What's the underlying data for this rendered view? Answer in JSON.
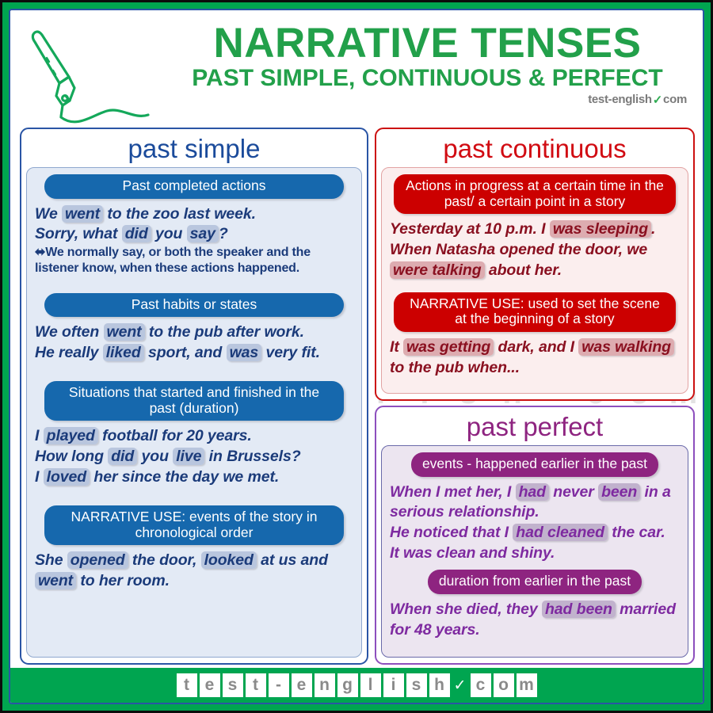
{
  "header": {
    "title": "NARRATIVE TENSES",
    "subtitle": "PAST SIMPLE, CONTINUOUS & PERFECT",
    "brand_left": "test-english",
    "brand_check": "✓",
    "brand_right": "com",
    "pen_icon": "fountain-pen-icon"
  },
  "colors": {
    "green": "#00A550",
    "blue": "#1668AD",
    "blue_text": "#1b4b9b",
    "red": "#CC0000",
    "red_text": "#d10b12",
    "purple": "#8E2480",
    "purple_text": "#8e2480",
    "highlight_blue": "#b9c6de",
    "highlight_red": "#ddacb0",
    "highlight_purple": "#c1b2cd"
  },
  "watermark": {
    "tiles": [
      "t",
      "e",
      "s",
      "t",
      "-",
      "e",
      "n",
      "g",
      "l",
      "i",
      "s",
      "h"
    ],
    "mark": "✓",
    "tail": [
      "c",
      "o",
      "m"
    ]
  },
  "past_simple": {
    "title": "past simple",
    "sections": [
      {
        "heading": "Past completed actions",
        "examples": [
          [
            {
              "t": "We ",
              "h": false
            },
            {
              "t": "went",
              "h": true
            },
            {
              "t": " to the zoo last week.",
              "h": false
            }
          ],
          [
            {
              "t": "Sorry, what ",
              "h": false
            },
            {
              "t": "did",
              "h": true
            },
            {
              "t": " you ",
              "h": false
            },
            {
              "t": "say",
              "h": true
            },
            {
              "t": "?",
              "h": false
            }
          ]
        ],
        "note": "⬌We normally say, or both the speaker and the listener know, when these actions happened."
      },
      {
        "heading": "Past habits or states",
        "examples": [
          [
            {
              "t": "We often ",
              "h": false
            },
            {
              "t": "went",
              "h": true
            },
            {
              "t": " to the pub after work.",
              "h": false
            }
          ],
          [
            {
              "t": "He really ",
              "h": false
            },
            {
              "t": "liked",
              "h": true
            },
            {
              "t": " sport, and ",
              "h": false
            },
            {
              "t": "was",
              "h": true
            },
            {
              "t": " very fit.",
              "h": false
            }
          ]
        ],
        "note": ""
      },
      {
        "heading": "Situations that started and finished in the past (duration)",
        "examples": [
          [
            {
              "t": "I ",
              "h": false
            },
            {
              "t": "played",
              "h": true
            },
            {
              "t": " football for 20 years.",
              "h": false
            }
          ],
          [
            {
              "t": "How long ",
              "h": false
            },
            {
              "t": "did",
              "h": true
            },
            {
              "t": " you ",
              "h": false
            },
            {
              "t": "live",
              "h": true
            },
            {
              "t": " in Brussels?",
              "h": false
            }
          ],
          [
            {
              "t": "I ",
              "h": false
            },
            {
              "t": "loved",
              "h": true
            },
            {
              "t": " her since the day we met.",
              "h": false
            }
          ]
        ],
        "note": ""
      },
      {
        "heading": "NARRATIVE USE: events of the story in chronological order",
        "examples": [
          [
            {
              "t": "She ",
              "h": false
            },
            {
              "t": "opened",
              "h": true
            },
            {
              "t": " the door, ",
              "h": false
            },
            {
              "t": "looked",
              "h": true
            },
            {
              "t": " at us and ",
              "h": false
            },
            {
              "t": "went",
              "h": true
            },
            {
              "t": " to her room.",
              "h": false
            }
          ]
        ],
        "note": ""
      }
    ]
  },
  "past_continuous": {
    "title": "past continuous",
    "sections": [
      {
        "heading": "Actions in progress at a certain time in the past/ a certain point in a story",
        "examples": [
          [
            {
              "t": "Yesterday at 10 p.m. I ",
              "h": false
            },
            {
              "t": "was sleeping",
              "h": true
            },
            {
              "t": ".",
              "h": false
            }
          ],
          [
            {
              "t": "When Natasha opened the door, we ",
              "h": false
            },
            {
              "t": "were talking",
              "h": true
            },
            {
              "t": " about her.",
              "h": false
            }
          ]
        ]
      },
      {
        "heading": "NARRATIVE USE: used to set the scene at the beginning of a story",
        "examples": [
          [
            {
              "t": "It ",
              "h": false
            },
            {
              "t": "was getting",
              "h": true
            },
            {
              "t": " dark, and I ",
              "h": false
            },
            {
              "t": "was walking",
              "h": true
            },
            {
              "t": " to the pub when...",
              "h": false
            }
          ]
        ]
      }
    ]
  },
  "past_perfect": {
    "title": "past perfect",
    "sections": [
      {
        "heading": "events - happened earlier in the past",
        "examples": [
          [
            {
              "t": "When I met her, I ",
              "h": false
            },
            {
              "t": "had",
              "h": true
            },
            {
              "t": " never ",
              "h": false
            },
            {
              "t": "been",
              "h": true
            },
            {
              "t": " in a serious relationship.",
              "h": false
            }
          ],
          [
            {
              "t": "He noticed that I ",
              "h": false
            },
            {
              "t": "had cleaned",
              "h": true
            },
            {
              "t": " the car.",
              "h": false
            }
          ],
          [
            {
              "t": "It was clean and shiny.",
              "h": false
            }
          ]
        ]
      },
      {
        "heading": "duration from earlier in the past",
        "examples": [
          [
            {
              "t": "When she died, they ",
              "h": false
            },
            {
              "t": "had been",
              "h": true
            },
            {
              "t": " married for 48 years.",
              "h": false
            }
          ]
        ]
      }
    ]
  },
  "footer": {
    "tiles": [
      "t",
      "e",
      "s",
      "t",
      "-",
      "e",
      "n",
      "g",
      "l",
      "i",
      "s",
      "h"
    ],
    "mark": "✓",
    "tail": [
      "c",
      "o",
      "m"
    ]
  }
}
